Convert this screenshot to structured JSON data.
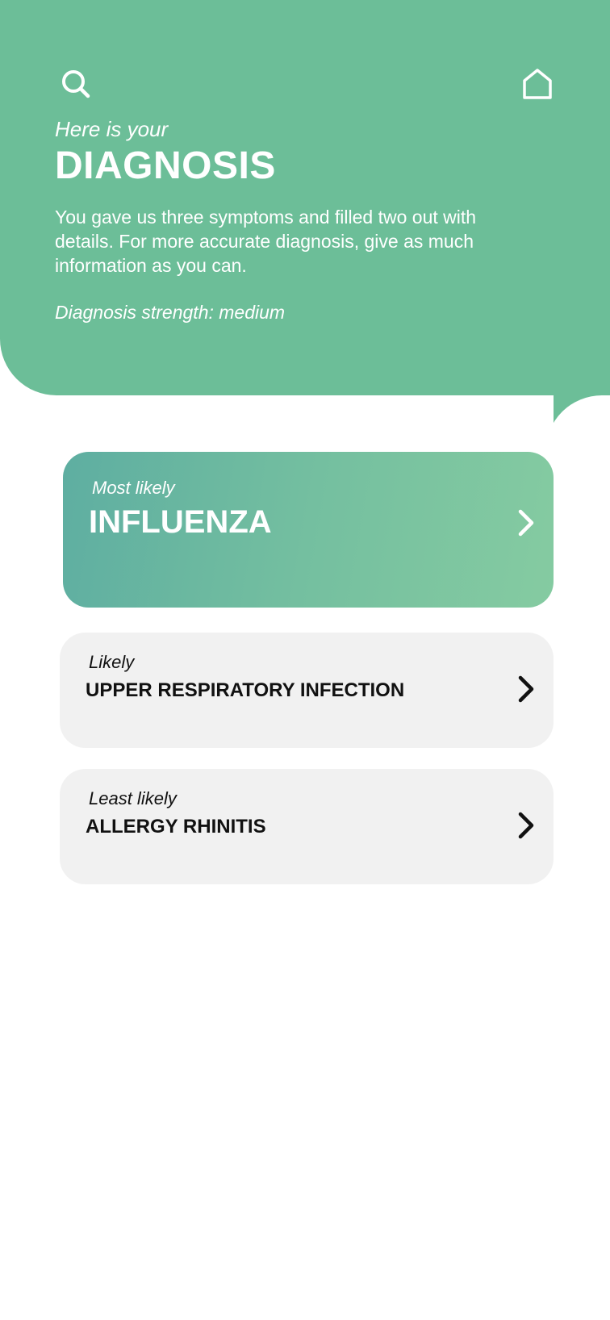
{
  "header": {
    "pre_title": "Here is your",
    "title": "DIAGNOSIS",
    "description": "You gave us three symptoms and filled two out with details. For more accurate diagnosis, give as much information as you can.",
    "strength": "Diagnosis strength: medium",
    "background_color": "#6cbe98",
    "icons": {
      "left": "search-icon",
      "right": "home-icon"
    }
  },
  "results": [
    {
      "likelihood": "Most likely",
      "name": "INFLUENZA",
      "icon": "chevron-right-icon"
    },
    {
      "likelihood": "Likely",
      "name": "UPPER RESPIRATORY INFECTION",
      "icon": "chevron-right-icon"
    },
    {
      "likelihood": "Least likely",
      "name": "ALLERGY RHINITIS",
      "icon": "chevron-right-icon"
    }
  ],
  "colors": {
    "accent": "#6cbe98",
    "gradient_start": "#5eaea1",
    "gradient_end": "#85cba1",
    "card_background": "#f1f1f1",
    "text_dark": "#111111"
  }
}
